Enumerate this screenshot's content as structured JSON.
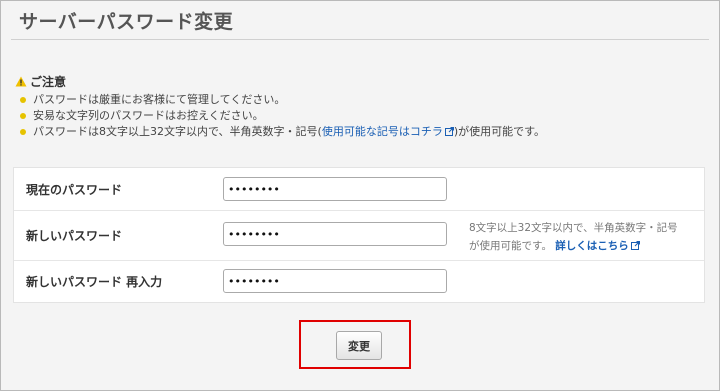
{
  "page": {
    "title": "サーバーパスワード変更"
  },
  "notice": {
    "heading": "ご注意",
    "items": [
      {
        "text": "パスワードは厳重にお客様にて管理してください。"
      },
      {
        "text": "安易な文字列のパスワードはお控えください。"
      },
      {
        "text_before": "パスワードは8文字以上32文字以内で、半角英数字・記号(",
        "link": "使用可能な記号はコチラ",
        "text_after": ")が使用可能です。"
      }
    ]
  },
  "form": {
    "current": {
      "label": "現在のパスワード",
      "value": "••••••••"
    },
    "new": {
      "label": "新しいパスワード",
      "value": "••••••••"
    },
    "confirm": {
      "label": "新しいパスワード 再入力",
      "value": "••••••••"
    },
    "hint": {
      "text": "8文字以上32文字以内で、半角英数字・記号が使用可能です。",
      "link": "詳しくはこちら"
    }
  },
  "submit": {
    "label": "変更"
  },
  "colors": {
    "highlight": "#e00000",
    "link": "#1a5fb4",
    "bullet": "#e6c300"
  }
}
